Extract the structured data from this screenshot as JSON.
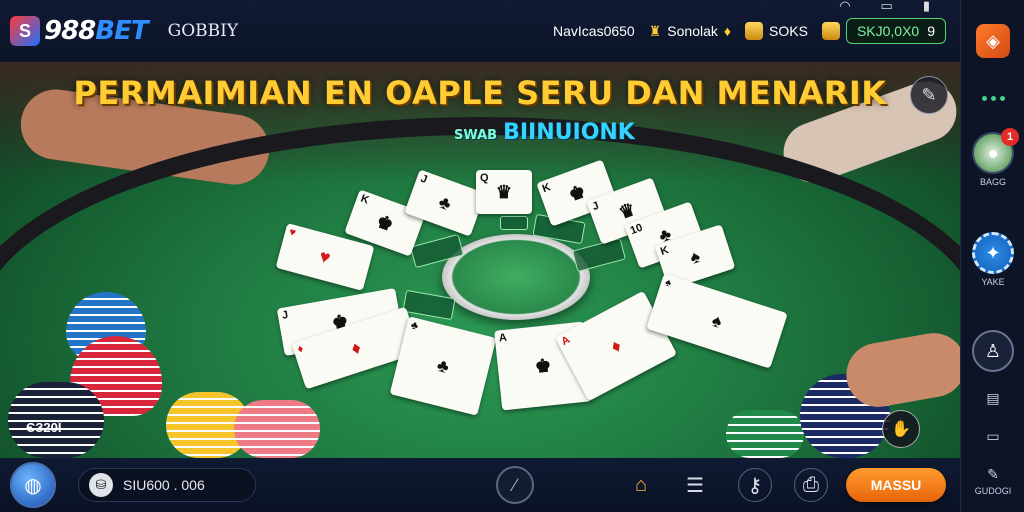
{
  "header": {
    "logo_mark": "S",
    "logo_primary": "988",
    "logo_secondary": "BET",
    "nav_label": "GOBBIY",
    "status_text": "NavIcas0650",
    "bonus_label": "Sonolak",
    "coins_label": "SOKS",
    "balance_value": "SKJ0,0X0",
    "balance_suffix": "9",
    "wifi_icon": "wifi-icon",
    "window_icon": "window-icon",
    "battery_icon": "battery-icon"
  },
  "game": {
    "headline": "PERMAIMIAN EN OAPLE SERU DAN MENARIK",
    "subhead_small": "SWAB",
    "subhead": "BIINUIONK",
    "chip_label": "ЄЗ20Ї",
    "cards": [
      "K",
      "Q",
      "J",
      "A",
      "K",
      "J",
      "♠",
      "♥",
      "♣",
      "♦",
      "A",
      "J",
      "Q",
      "K",
      "10"
    ]
  },
  "sidebar": {
    "items": [
      {
        "label": "",
        "icon": "cube-logo-icon"
      },
      {
        "label": "",
        "icon": "dots-icon"
      },
      {
        "label": "BAGG",
        "icon": "game-ball-icon",
        "badge": "1"
      },
      {
        "label": "YAKE",
        "icon": "poker-chip-icon"
      },
      {
        "label": "",
        "icon": "person-icon"
      },
      {
        "label": "",
        "icon": "wallet-icon"
      },
      {
        "label": "",
        "icon": "battery-icon"
      },
      {
        "label": "GUDOGI",
        "icon": "pen-icon"
      }
    ]
  },
  "bottombar": {
    "wallet_value": "SIU600 . 006",
    "login_label": "MASSU",
    "icons": [
      "globe-icon",
      "wallet-icon",
      "slash-icon",
      "gift-icon",
      "list-icon",
      "key-icon",
      "camera-icon"
    ]
  },
  "colors": {
    "felt": "#1f7a41",
    "accent_gold": "#ffcc33",
    "accent_cyan": "#35d3ff",
    "button_orange": "#f07a14"
  }
}
